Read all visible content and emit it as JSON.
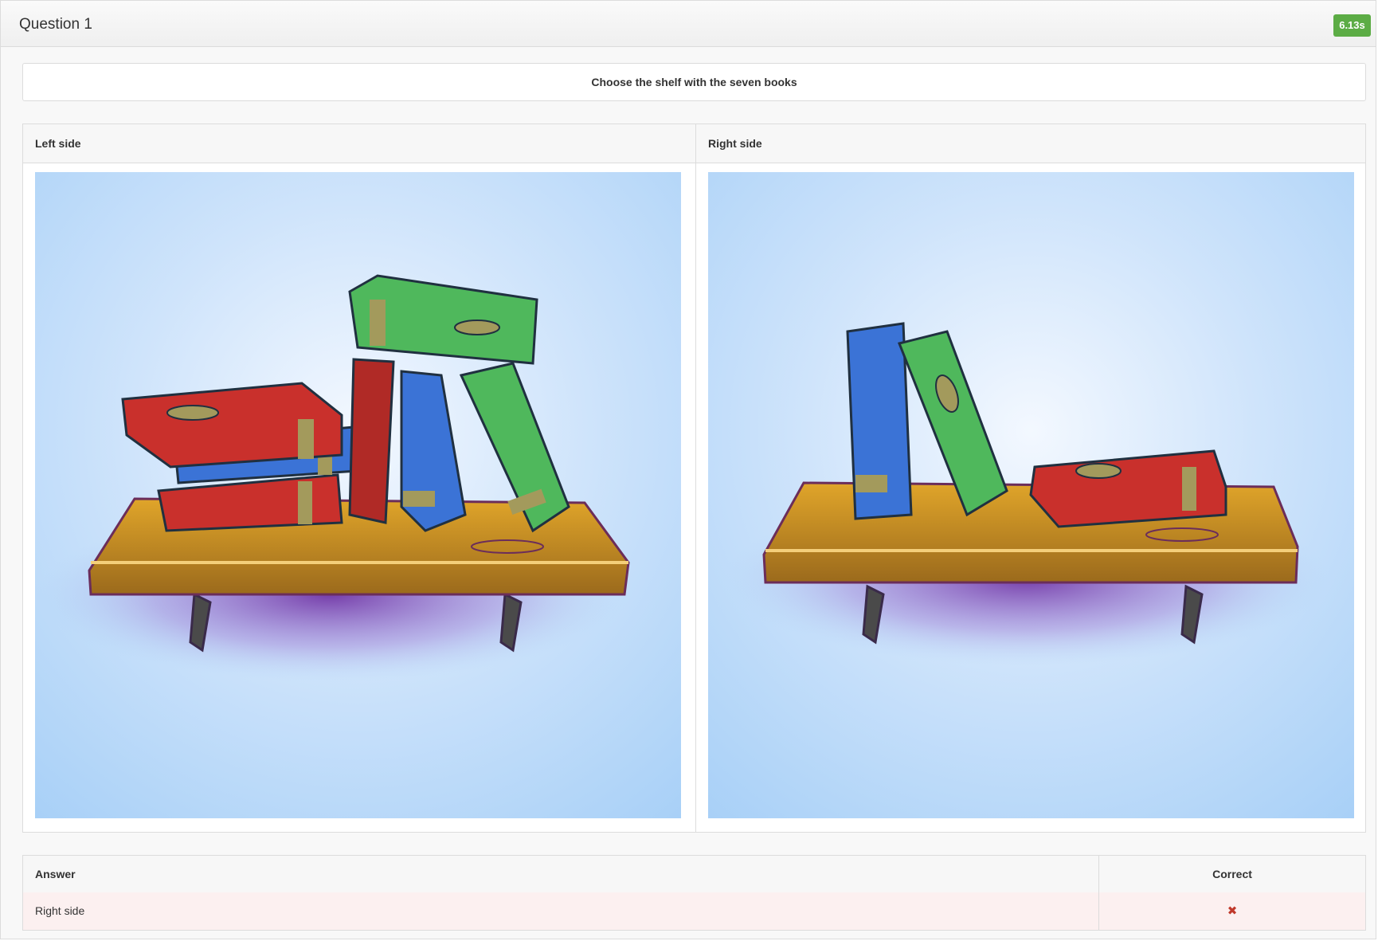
{
  "question": {
    "title": "Question 1",
    "timer": "6.13s",
    "prompt": "Choose the shelf with the seven books"
  },
  "choices": [
    {
      "label": "Left side"
    },
    {
      "label": "Right side"
    }
  ],
  "answers": {
    "headers": {
      "answer": "Answer",
      "correct": "Correct"
    },
    "rows": [
      {
        "answer": "Right side",
        "correct_icon": "cross-icon",
        "correct_symbol": "✖"
      }
    ]
  },
  "colors": {
    "badge": "#5cac45",
    "incorrect_row": "#fcf0f0",
    "incorrect_mark": "#c0392b"
  }
}
